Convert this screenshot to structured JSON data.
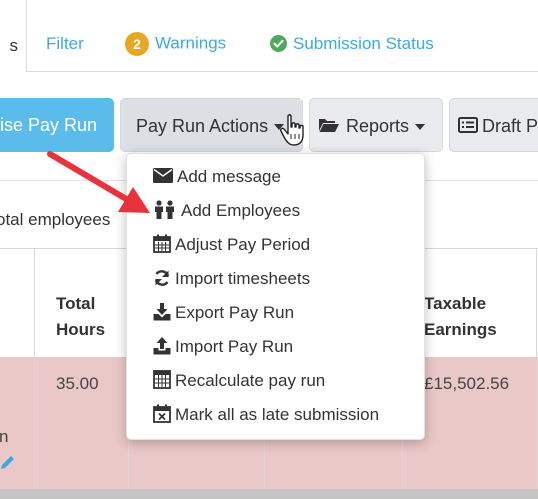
{
  "tabs": {
    "partial_active": "s",
    "filter": "Filter",
    "warnings_count": "2",
    "warnings": "Warnings",
    "submission_status": "Submission Status"
  },
  "toolbar": {
    "finalise": "ise Pay Run",
    "pay_run_actions": "Pay Run Actions",
    "reports": "Reports",
    "draft": "Draft Pa"
  },
  "summary": {
    "total_employees": "otal employees"
  },
  "table": {
    "headers": {
      "total_hours_1": "Total",
      "total_hours_2": "Hours",
      "taxable_1": "Taxable",
      "taxable_2": "Earnings"
    },
    "row": {
      "total_hours": "35.00",
      "taxable_earnings": "£15,502.56",
      "name_partial": "n"
    }
  },
  "menu": {
    "items": [
      {
        "label": "Add message",
        "icon": "envelope-icon"
      },
      {
        "label": "Add Employees",
        "icon": "people-icon"
      },
      {
        "label": "Adjust Pay Period",
        "icon": "calendar-icon"
      },
      {
        "label": "Import timesheets",
        "icon": "refresh-icon"
      },
      {
        "label": "Export Pay Run",
        "icon": "download-icon"
      },
      {
        "label": "Import Pay Run",
        "icon": "upload-icon"
      },
      {
        "label": "Recalculate pay run",
        "icon": "calculator-icon"
      },
      {
        "label": "Mark all as late submission",
        "icon": "calendar-x-icon"
      }
    ]
  },
  "colors": {
    "accent_blue": "#5bbcec",
    "link_blue": "#3fa8e0",
    "warning_orange": "#e8a723",
    "success_green": "#4caa5a",
    "row_pink": "#eac8c8",
    "arrow_red": "#e8323c"
  }
}
